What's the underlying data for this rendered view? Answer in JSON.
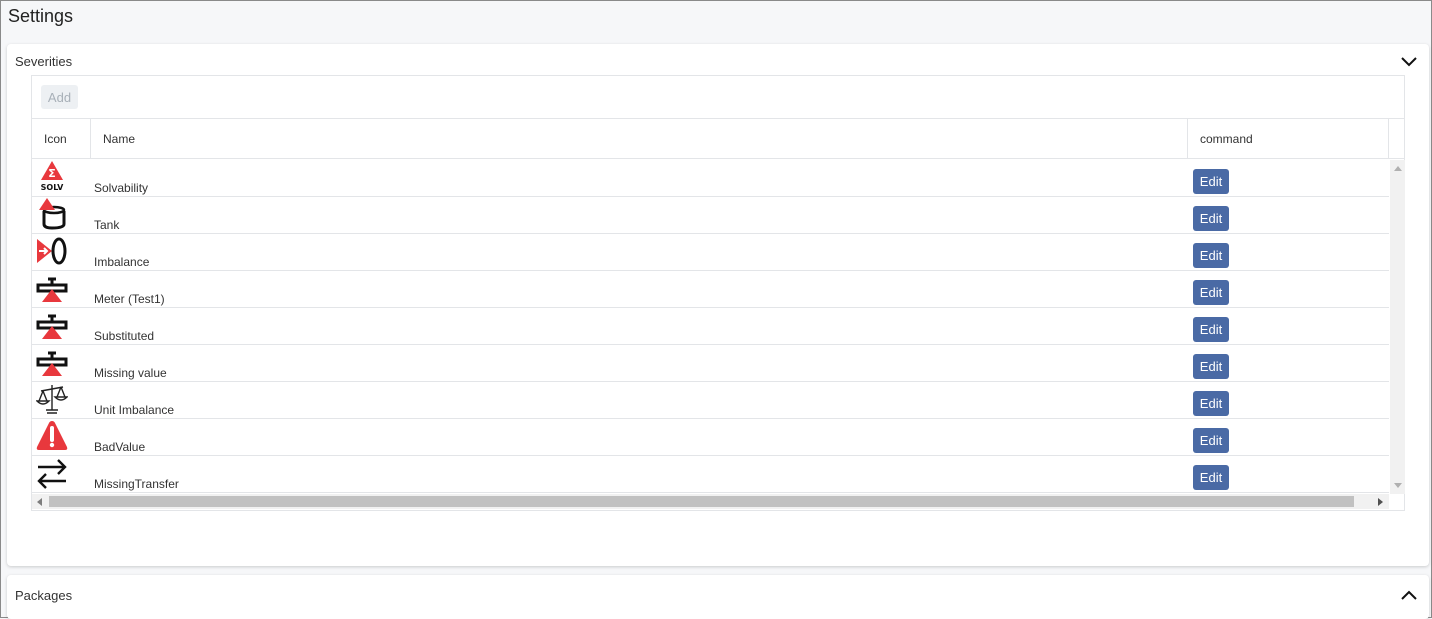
{
  "page": {
    "title": "Settings"
  },
  "severities": {
    "title": "Severities",
    "expanded": true,
    "add_label": "Add",
    "columns": [
      "Icon",
      "Name",
      "command"
    ],
    "rows": [
      {
        "icon": "solvability-icon",
        "name": "Solvability",
        "action": "Edit"
      },
      {
        "icon": "tank-icon",
        "name": "Tank",
        "action": "Edit"
      },
      {
        "icon": "imbalance-icon",
        "name": "Imbalance",
        "action": "Edit"
      },
      {
        "icon": "meter-icon",
        "name": "Meter (Test1)",
        "action": "Edit"
      },
      {
        "icon": "meter-icon",
        "name": "Substituted",
        "action": "Edit"
      },
      {
        "icon": "meter-icon",
        "name": "Missing value",
        "action": "Edit"
      },
      {
        "icon": "scale-icon",
        "name": "Unit Imbalance",
        "action": "Edit"
      },
      {
        "icon": "warning-icon",
        "name": "BadValue",
        "action": "Edit"
      },
      {
        "icon": "transfer-arrows-icon",
        "name": "MissingTransfer",
        "action": "Edit"
      }
    ]
  },
  "packages": {
    "title": "Packages",
    "expanded": false
  },
  "icons": {
    "solv_text": "SOLV"
  },
  "colors": {
    "edit_button": "#4a6aa5",
    "icon_red": "#e8383d"
  }
}
